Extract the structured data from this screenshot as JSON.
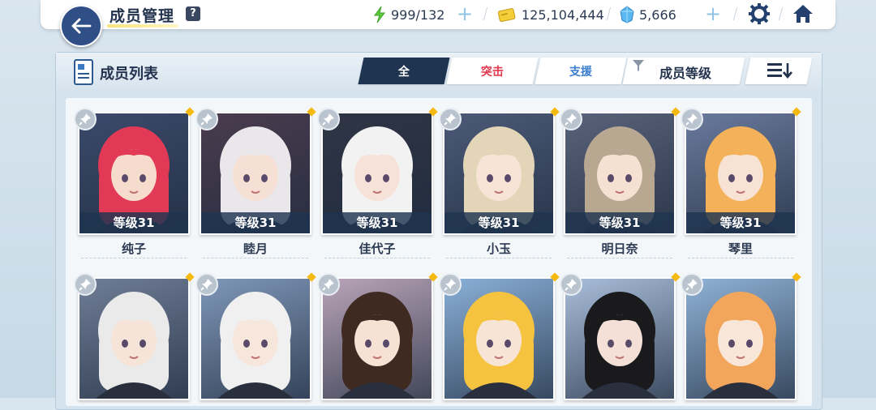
{
  "header": {
    "title": "成员管理",
    "help_label": "?",
    "ap": "999/132",
    "credits": "125,104,444",
    "gems": "5,666",
    "plus": "+"
  },
  "panel": {
    "title": "成员列表",
    "tabs": [
      {
        "label": "全"
      },
      {
        "label": "突击"
      },
      {
        "label": "支援"
      }
    ],
    "sort_label": "成员等级"
  },
  "members": [
    {
      "name": "纯子",
      "level": "等级31",
      "bg": "#3b4a6b",
      "hair": "#e23a56",
      "skin": "#f5dccd"
    },
    {
      "name": "睦月",
      "level": "等级31",
      "bg": "#4a3c4e",
      "hair": "#e9e7ea",
      "skin": "#f6e0d6"
    },
    {
      "name": "佳代子",
      "level": "等级31",
      "bg": "#2f3545",
      "hair": "#f2f2f2",
      "skin": "#f6e2d8"
    },
    {
      "name": "小玉",
      "level": "等级31",
      "bg": "#4c5a78",
      "hair": "#e3d6b8",
      "skin": "#f7e4d6"
    },
    {
      "name": "明日奈",
      "level": "等级31",
      "bg": "#58627a",
      "hair": "#b8a892",
      "skin": "#f6e0d2"
    },
    {
      "name": "琴里",
      "level": "等级31",
      "bg": "#6a7a9c",
      "hair": "#f3b25a",
      "skin": "#f7e2d3"
    },
    {
      "name": "",
      "level": "",
      "bg": "#6f7d96",
      "hair": "#eaeaea",
      "skin": "#f6e4d8"
    },
    {
      "name": "",
      "level": "",
      "bg": "#7f97b8",
      "hair": "#f0f0f0",
      "skin": "#f7e6db"
    },
    {
      "name": "",
      "level": "",
      "bg": "#b9a4b8",
      "hair": "#3f2a22",
      "skin": "#f7e1d4"
    },
    {
      "name": "",
      "level": "",
      "bg": "#8ab0d8",
      "hair": "#f5c340",
      "skin": "#f8e4d4"
    },
    {
      "name": "",
      "level": "",
      "bg": "#a9bedb",
      "hair": "#1a1a1d",
      "skin": "#f4e0d6"
    },
    {
      "name": "",
      "level": "",
      "bg": "#8fb2d6",
      "hair": "#f2a65c",
      "skin": "#f8e6d8"
    }
  ]
}
